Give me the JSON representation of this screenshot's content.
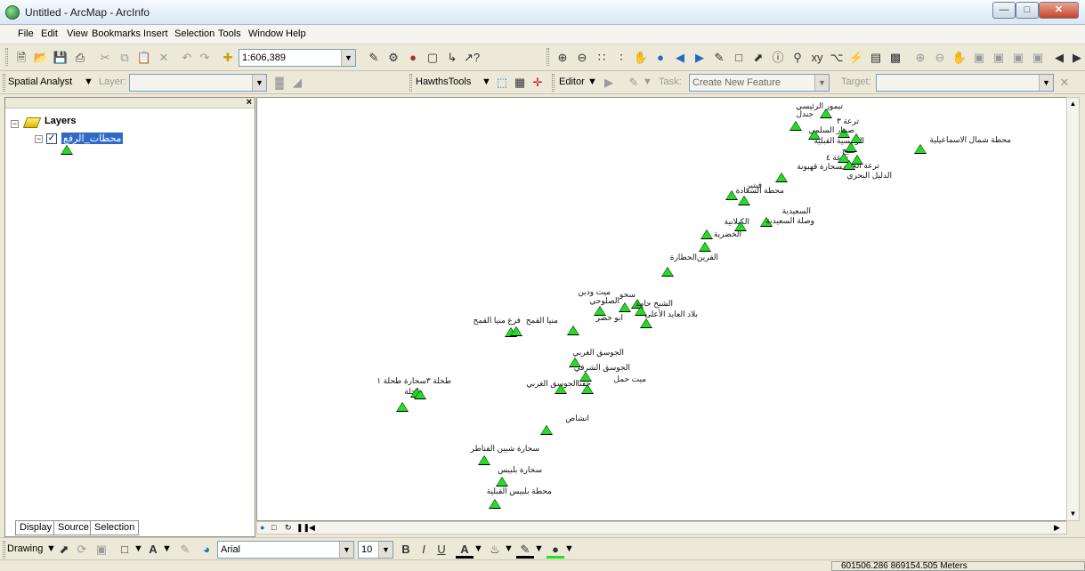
{
  "window": {
    "title": "Untitled - ArcMap - ArcInfo"
  },
  "menu": [
    "File",
    "Edit",
    "View",
    "Bookmarks",
    "Insert",
    "Selection",
    "Tools",
    "Window",
    "Help"
  ],
  "standard_toolbar": {
    "scale": "1:606,389"
  },
  "spatial_analyst": {
    "label": "Spatial Analyst",
    "layer_label": "Layer:"
  },
  "hawths": {
    "label": "HawthsTools"
  },
  "editor": {
    "label": "Editor",
    "task_label": "Task:",
    "task_value": "Create New Feature",
    "target_label": "Target:"
  },
  "toc": {
    "root_label": "Layers",
    "layer_name": "محطات_الرفع",
    "tabs": [
      "Display",
      "Source",
      "Selection"
    ]
  },
  "map": {
    "points": [
      {
        "label": "تيمور الرئيسي"
      },
      {
        "label": "جندل"
      },
      {
        "label": "ترعة ٣"
      },
      {
        "label": "صنبار السلمي"
      },
      {
        "label": "الرئيسية القبلية"
      },
      {
        "label": "خليج"
      },
      {
        "label": "ترعة ٤"
      },
      {
        "label": "ترعة الحيلى"
      },
      {
        "label": "الدليل البحري"
      },
      {
        "label": "محطة شمال الاسماعيلية"
      },
      {
        "label": "سحارة قهبونة"
      },
      {
        "label": "محطة السعادة"
      },
      {
        "label": "فيتير"
      },
      {
        "label": "السعيدية"
      },
      {
        "label": "وصلة السعيدية"
      },
      {
        "label": "الكيلانية"
      },
      {
        "label": "الخضرية"
      },
      {
        "label": "القرين"
      },
      {
        "label": "الحطارة"
      },
      {
        "label": "ميت ودين"
      },
      {
        "label": "سحو"
      },
      {
        "label": "الصلوحي"
      },
      {
        "label": "الشيخ حامد"
      },
      {
        "label": "بلاد العايد الأعلى"
      },
      {
        "label": "ابو خضر"
      },
      {
        "label": "منيا القمح"
      },
      {
        "label": "فرع منيا القمح"
      },
      {
        "label": "الجوسق الغربي"
      },
      {
        "label": "الجوسق الشرقي"
      },
      {
        "label": "ميت حمل"
      },
      {
        "label": "حفنا"
      },
      {
        "label": "الجوسق الغربي"
      },
      {
        "label": "طحلة ٣"
      },
      {
        "label": "سحارة طحلة ١"
      },
      {
        "label": "طحلة"
      },
      {
        "label": "انشاص"
      },
      {
        "label": "سحارة شبين القناطر"
      },
      {
        "label": "سحارة بلبيس"
      },
      {
        "label": "محطة بلبيس القبلية"
      }
    ]
  },
  "drawing_toolbar": {
    "label": "Drawing",
    "font": "Arial",
    "size": "10"
  },
  "status": {
    "coords": "601506.286  869154.505 Meters"
  }
}
